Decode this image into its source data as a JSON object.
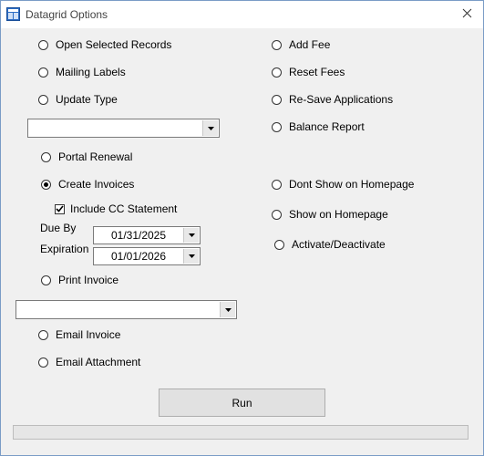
{
  "window": {
    "title": "Datagrid Options"
  },
  "left_options": {
    "open_selected_records": "Open Selected Records",
    "mailing_labels": "Mailing Labels",
    "update_type": "Update Type",
    "update_type_select": "",
    "portal_renewal": "Portal Renewal",
    "create_invoices": "Create Invoices",
    "include_cc_statement": "Include CC Statement",
    "due_by_label": "Due By",
    "due_by_value": "01/31/2025",
    "expiration_label": "Expiration",
    "expiration_value": "01/01/2026",
    "print_invoice": "Print Invoice",
    "print_invoice_select": "",
    "email_invoice": "Email Invoice",
    "email_attachment": "Email Attachment"
  },
  "right_options": {
    "add_fee": "Add Fee",
    "reset_fees": "Reset Fees",
    "re_save_applications": "Re-Save Applications",
    "balance_report": "Balance Report",
    "dont_show_on_homepage": "Dont Show on Homepage",
    "show_on_homepage": "Show on Homepage",
    "activate_deactivate": "Activate/Deactivate"
  },
  "state": {
    "selected_option": "Create Invoices",
    "include_cc_statement_checked": true,
    "progress": 0
  },
  "actions": {
    "run_label": "Run"
  },
  "colors": {
    "accent": "#7a9cc6",
    "progress_fill": "#06b025"
  }
}
